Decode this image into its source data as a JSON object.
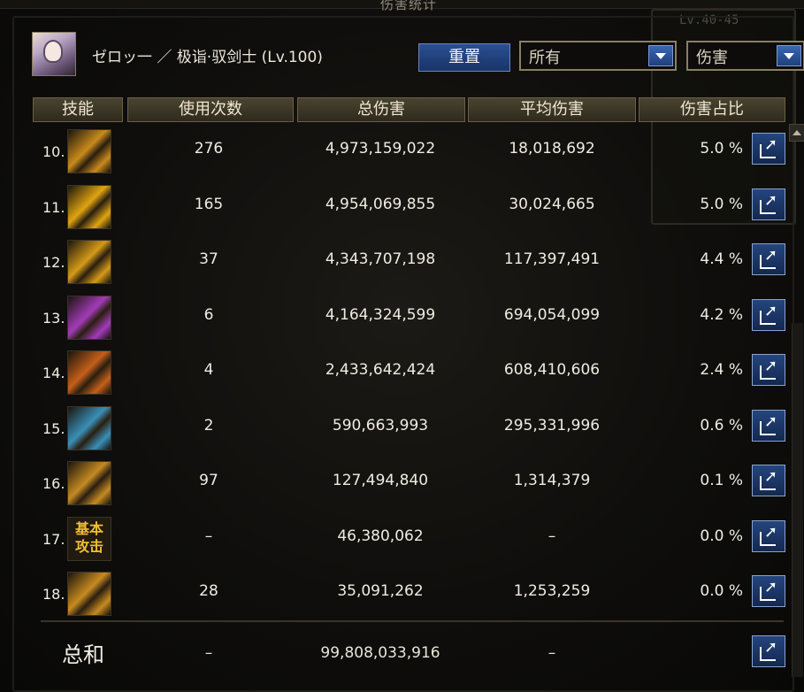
{
  "window": {
    "title": "伤害统计",
    "level_range": "Lv.40-45"
  },
  "character": {
    "name": "ゼロッ一 ／ 极诣·驭剑士 (Lv.100)"
  },
  "controls": {
    "reset_label": "重置",
    "filter_dropdown": "所有",
    "metric_dropdown": "伤害"
  },
  "columns": [
    "技能",
    "使用次数",
    "总伤害",
    "平均伤害",
    "伤害占比"
  ],
  "rows": [
    {
      "num": "10.",
      "uses": "276",
      "total": "4,973,159,022",
      "avg": "18,018,692",
      "pct": "5.0 %"
    },
    {
      "num": "11.",
      "uses": "165",
      "total": "4,954,069,855",
      "avg": "30,024,665",
      "pct": "5.0 %"
    },
    {
      "num": "12.",
      "uses": "37",
      "total": "4,343,707,198",
      "avg": "117,397,491",
      "pct": "4.4 %"
    },
    {
      "num": "13.",
      "uses": "6",
      "total": "4,164,324,599",
      "avg": "694,054,099",
      "pct": "4.2 %"
    },
    {
      "num": "14.",
      "uses": "4",
      "total": "2,433,642,424",
      "avg": "608,410,606",
      "pct": "2.4 %"
    },
    {
      "num": "15.",
      "uses": "2",
      "total": "590,663,993",
      "avg": "295,331,996",
      "pct": "0.6 %"
    },
    {
      "num": "16.",
      "uses": "97",
      "total": "127,494,840",
      "avg": "1,314,379",
      "pct": "0.1 %"
    },
    {
      "num": "17.",
      "uses": "–",
      "total": "46,380,062",
      "avg": "–",
      "pct": "0.0 %",
      "icon_text": "基本攻击"
    },
    {
      "num": "18.",
      "uses": "28",
      "total": "35,091,262",
      "avg": "1,253,259",
      "pct": "0.0 %"
    }
  ],
  "summary": {
    "label": "总和",
    "uses": "–",
    "total": "99,808,033,916",
    "avg": "–"
  },
  "icon_colors": [
    "#c98a1c",
    "#e0a412",
    "#d49a18",
    "#a23bb8",
    "#c4601a",
    "#3a8fb8",
    "#c48a22",
    "#2a2418",
    "#c78a20"
  ],
  "accent": {
    "button_blue": "#1f3f7a",
    "header_gold": "#4a4330"
  }
}
